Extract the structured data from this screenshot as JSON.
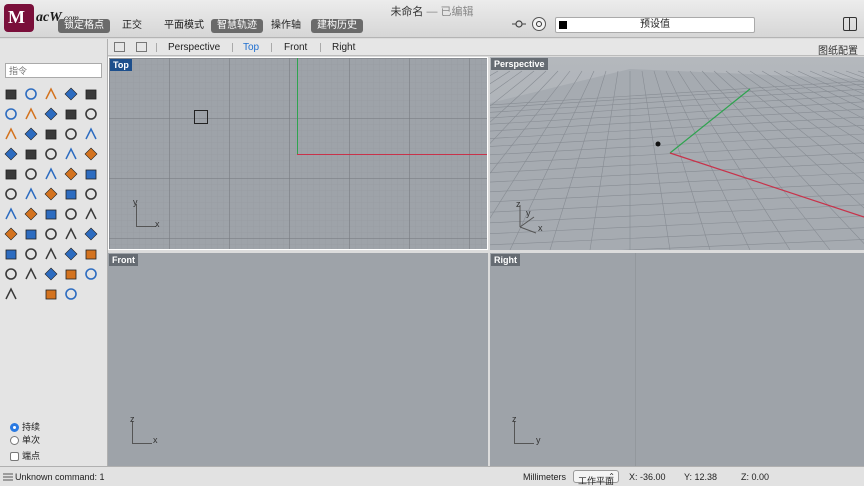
{
  "window": {
    "title": "未命名",
    "subtitle": " — 已编辑",
    "logo_letter": "M",
    "logo_text": "acW",
    "logo_suffix": ".com"
  },
  "toolbar": {
    "buttons": [
      {
        "label": "锁定格点",
        "dark": true
      },
      {
        "label": "正交",
        "dark": false
      },
      {
        "label": "平面模式",
        "dark": false
      },
      {
        "label": "智慧轨迹",
        "dark": true
      },
      {
        "label": "操作轴",
        "dark": false
      },
      {
        "label": "建构历史",
        "dark": true
      }
    ],
    "preset_label": "预设值"
  },
  "tabs": {
    "items": [
      "Perspective",
      "Top",
      "Front",
      "Right"
    ],
    "active": "Top",
    "right_label": "图纸配置"
  },
  "command": {
    "placeholder": "指令"
  },
  "options": {
    "radio1": "持续",
    "radio2": "单次",
    "checkbox": "端点"
  },
  "viewports": {
    "top": {
      "label": "Top",
      "x_axis": "x",
      "y_axis": "y"
    },
    "perspective": {
      "label": "Perspective",
      "x_axis": "x",
      "y_axis": "y",
      "z_axis": "z"
    },
    "front": {
      "label": "Front",
      "x_axis": "x",
      "z_axis": "z"
    },
    "right": {
      "label": "Right",
      "y_axis": "y",
      "z_axis": "z"
    }
  },
  "status": {
    "message": "Unknown command: 1",
    "units": "Millimeters",
    "plane": "工作平面",
    "x": "X: -36.00",
    "y": "Y: 12.38",
    "z": "Z: 0.00"
  },
  "colors": {
    "x_axis": "#c8324a",
    "y_axis": "#2ea44f",
    "active_tab": "#1f6fd0",
    "viewport_bg": "#9ea3a9"
  }
}
